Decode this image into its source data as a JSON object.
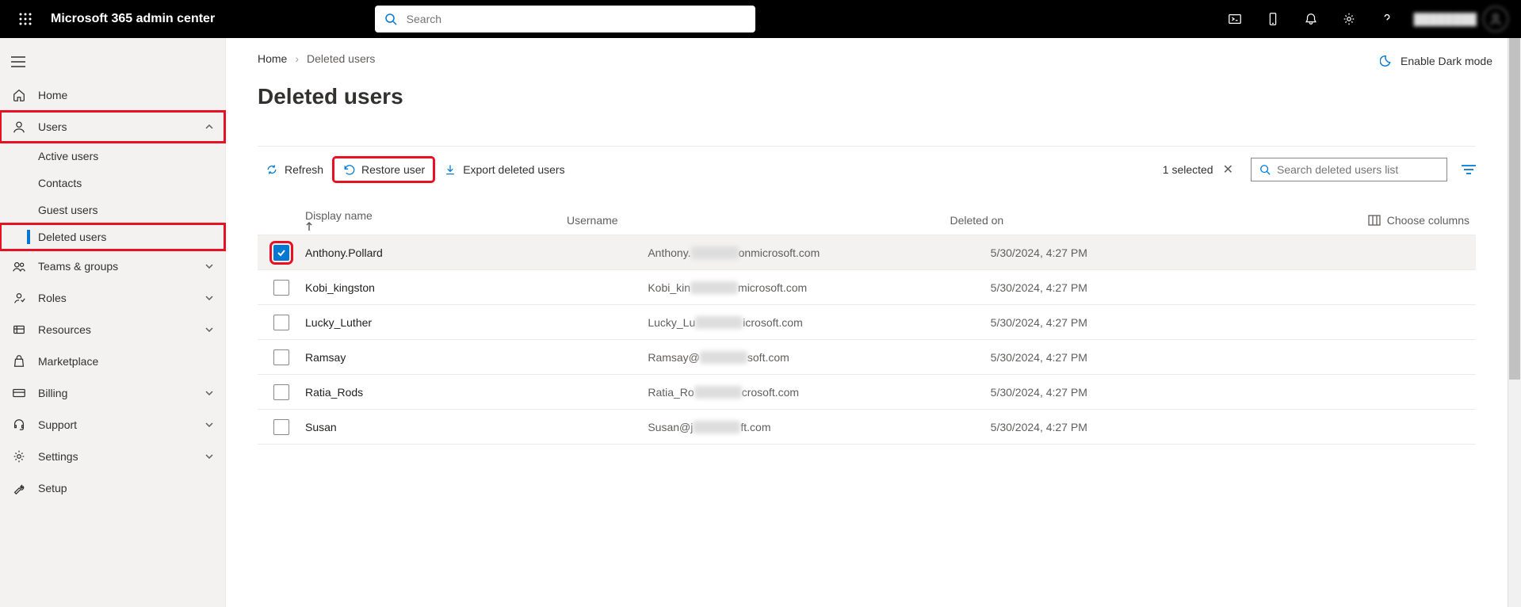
{
  "header": {
    "brand": "Microsoft 365 admin center",
    "search_placeholder": "Search",
    "username_display": "████████"
  },
  "sidebar": {
    "home": "Home",
    "users": "Users",
    "users_children": {
      "active": "Active users",
      "contacts": "Contacts",
      "guest": "Guest users",
      "deleted": "Deleted users"
    },
    "teams": "Teams & groups",
    "roles": "Roles",
    "resources": "Resources",
    "marketplace": "Marketplace",
    "billing": "Billing",
    "support": "Support",
    "settings": "Settings",
    "setup": "Setup"
  },
  "breadcrumb": {
    "home": "Home",
    "current": "Deleted users"
  },
  "dark_mode_label": "Enable Dark mode",
  "page_title": "Deleted users",
  "commands": {
    "refresh": "Refresh",
    "restore": "Restore user",
    "export": "Export deleted users",
    "selected": "1 selected",
    "search_placeholder": "Search deleted users list"
  },
  "columns": {
    "display_name": "Display name",
    "username": "Username",
    "deleted_on": "Deleted on",
    "choose": "Choose columns"
  },
  "rows": [
    {
      "selected": true,
      "name": "Anthony.Pollard",
      "user_pre": "Anthony.",
      "user_post": "onmicrosoft.com",
      "deleted": "5/30/2024, 4:27 PM"
    },
    {
      "selected": false,
      "name": "Kobi_kingston",
      "user_pre": "Kobi_kin",
      "user_post": "microsoft.com",
      "deleted": "5/30/2024, 4:27 PM"
    },
    {
      "selected": false,
      "name": "Lucky_Luther",
      "user_pre": "Lucky_Lu",
      "user_post": "icrosoft.com",
      "deleted": "5/30/2024, 4:27 PM"
    },
    {
      "selected": false,
      "name": "Ramsay",
      "user_pre": "Ramsay@",
      "user_post": "soft.com",
      "deleted": "5/30/2024, 4:27 PM"
    },
    {
      "selected": false,
      "name": "Ratia_Rods",
      "user_pre": "Ratia_Ro",
      "user_post": "crosoft.com",
      "deleted": "5/30/2024, 4:27 PM"
    },
    {
      "selected": false,
      "name": "Susan",
      "user_pre": "Susan@j",
      "user_post": "ft.com",
      "deleted": "5/30/2024, 4:27 PM"
    }
  ]
}
